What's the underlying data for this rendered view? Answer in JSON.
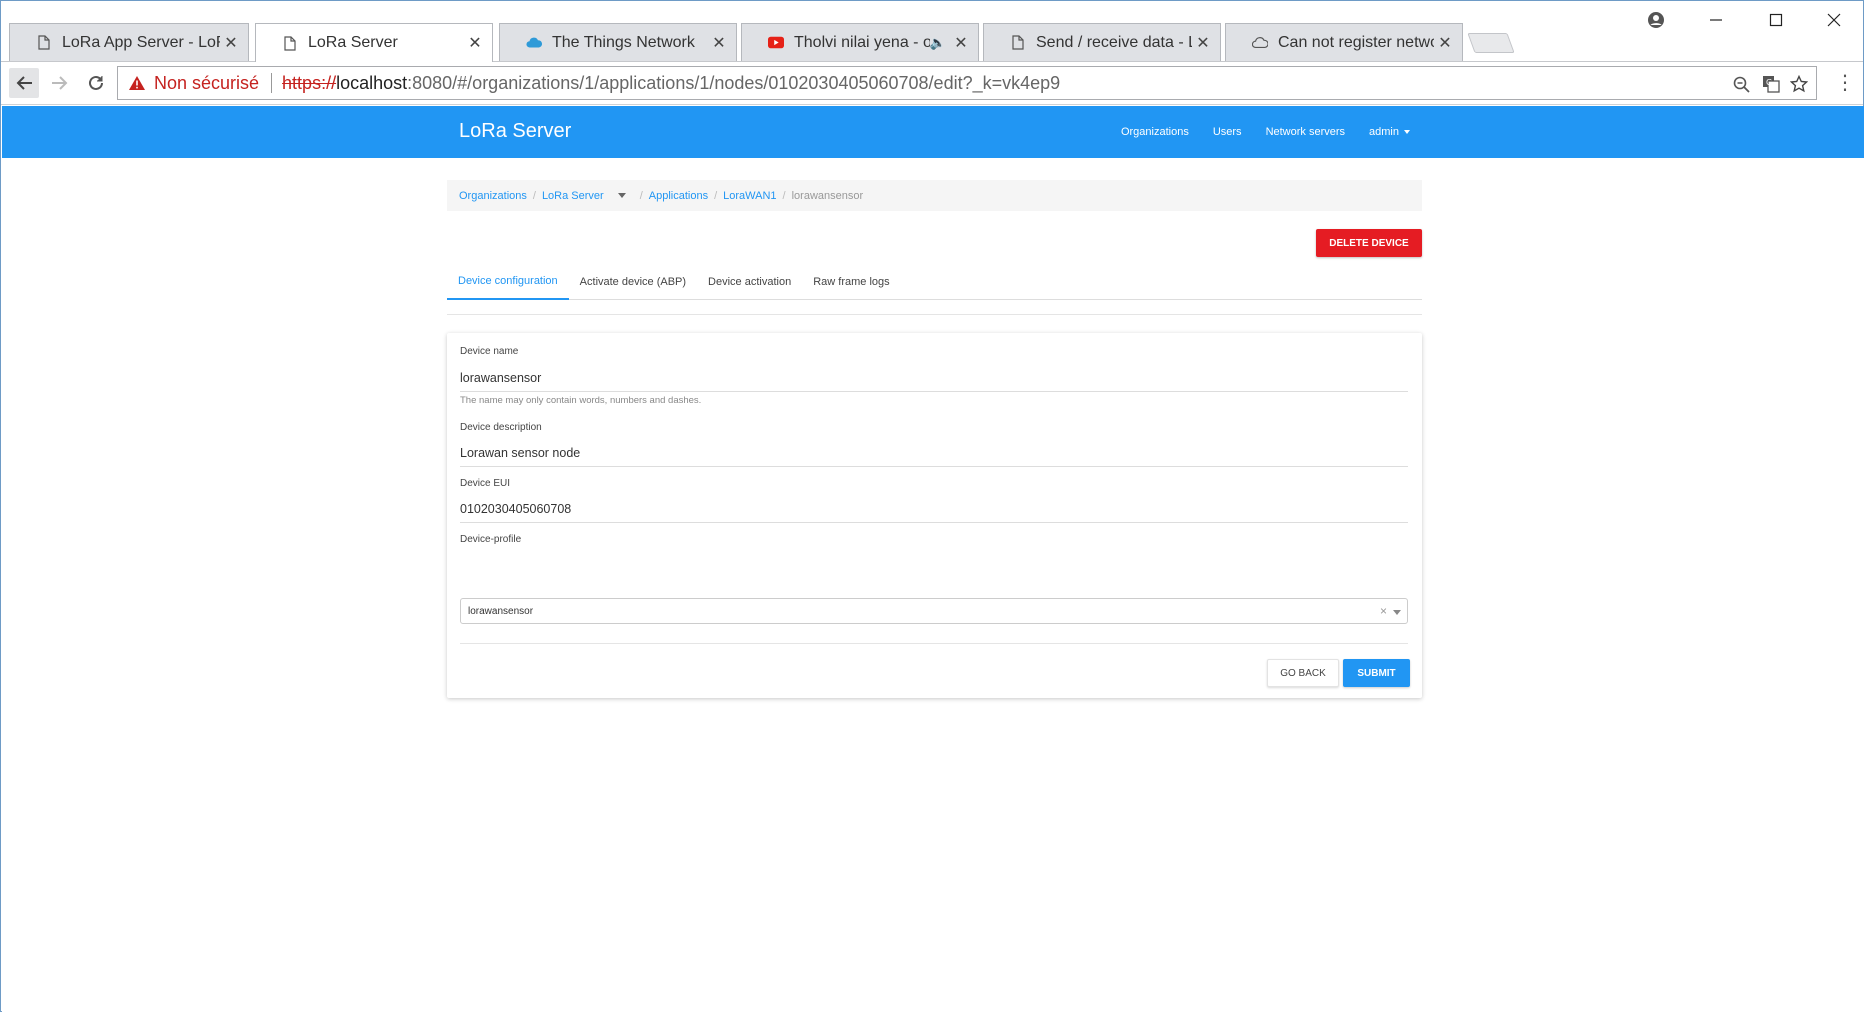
{
  "browser": {
    "tabs": [
      {
        "title": "LoRa App Server - LoRa A",
        "icon": "page-icon"
      },
      {
        "title": "LoRa Server",
        "icon": "page-icon",
        "active": true
      },
      {
        "title": "The Things Network",
        "icon": "cloud-icon"
      },
      {
        "title": "Tholvi nilai yena - oor",
        "icon": "youtube-icon",
        "audio": true
      },
      {
        "title": "Send / receive data - LoR",
        "icon": "page-icon"
      },
      {
        "title": "Can not register network",
        "icon": "cloud-link-icon"
      }
    ],
    "address": {
      "security_label": "Non sécurisé",
      "scheme": "https://",
      "host": "localhost",
      "rest": ":8080/#/organizations/1/applications/1/nodes/0102030405060708/edit?_k=vk4ep9"
    },
    "tab_close_glyph": "✕"
  },
  "app": {
    "brand": "LoRa Server",
    "nav": {
      "organizations": "Organizations",
      "users": "Users",
      "network_servers": "Network servers",
      "admin": "admin"
    },
    "breadcrumb": {
      "organizations": "Organizations",
      "org": "LoRa Server",
      "applications": "Applications",
      "application": "LoraWAN1",
      "current": "lorawansensor",
      "separator": "/"
    },
    "delete_button": "DELETE DEVICE",
    "tabs": [
      "Device configuration",
      "Activate device (ABP)",
      "Device activation",
      "Raw frame logs"
    ],
    "form": {
      "device_name_label": "Device name",
      "device_name_value": "lorawansensor",
      "device_name_help": "The name may only contain words, numbers and dashes.",
      "device_description_label": "Device description",
      "device_description_value": "Lorawan sensor node",
      "device_eui_label": "Device EUI",
      "device_eui_value": "0102030405060708",
      "device_profile_label": "Device-profile",
      "device_profile_value": "lorawansensor",
      "clear_glyph": "×",
      "go_back": "GO BACK",
      "submit": "SUBMIT"
    }
  },
  "colors": {
    "primary": "#2196f3",
    "danger": "#e51c23",
    "insecure": "#c5221f"
  }
}
